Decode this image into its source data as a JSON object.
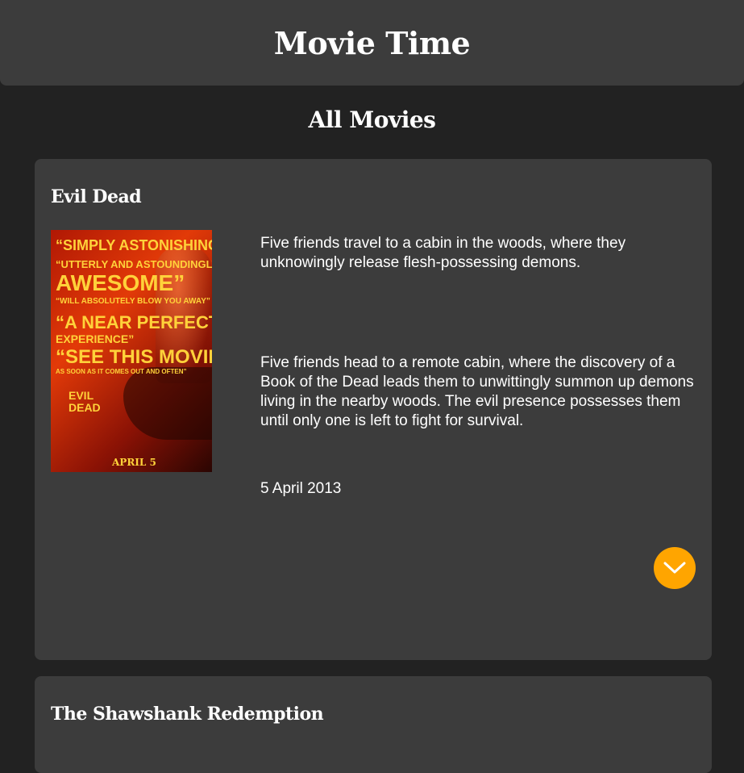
{
  "header": {
    "title": "Movie Time"
  },
  "main": {
    "section_title": "All Movies",
    "movies": [
      {
        "title": "Evil Dead",
        "short_description": "Five friends travel to a cabin in the woods, where they unknowingly release flesh-possessing demons.",
        "long_description": "Five friends head to a remote cabin, where the discovery of a Book of the Dead leads them to unwittingly summon up demons living in the nearby woods. The evil presence possesses them until only one is left to fight for survival.",
        "release_date": "5 April 2013",
        "poster": {
          "lines": [
            "“SIMPLY ASTONISHING”",
            "“UTTERLY AND ASTOUNDINGLY",
            "AWESOME”",
            "“WILL ABSOLUTELY BLOW YOU AWAY”",
            "“A NEAR PERFECT",
            "EXPERIENCE”",
            "“SEE THIS MOVIE",
            "AS SOON AS IT COMES OUT AND OFTEN”",
            "EVIL\nDEAD",
            "APRIL 5"
          ]
        },
        "expand_icon": "chevron-down-icon"
      },
      {
        "title": "The Shawshank Redemption"
      }
    ]
  },
  "colors": {
    "page_background": "#222222",
    "card_background": "#3c3c3c",
    "accent": "#ffa500",
    "text": "#ffffff"
  }
}
